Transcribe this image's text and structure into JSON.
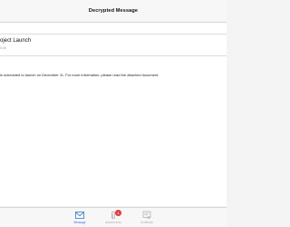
{
  "navbar": {
    "title": "Decrypted Message"
  },
  "message": {
    "subject": "oject Launch",
    "time": "0:40",
    "body": "is scheduled to launch on December 11. For more information, please read the attached document."
  },
  "tabbar": {
    "tabs": [
      {
        "label": "Message",
        "icon": "envelope-icon",
        "active": true
      },
      {
        "label": "Attachments",
        "icon": "paperclip-icon",
        "badge": "1",
        "active": false
      },
      {
        "label": "Certificate",
        "icon": "certificate-icon",
        "active": false
      }
    ]
  },
  "colors": {
    "accent": "#2a7bd6",
    "badge": "#e53935",
    "inactive": "#b3b3b3"
  }
}
